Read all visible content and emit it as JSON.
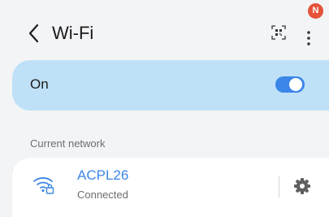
{
  "header": {
    "title": "Wi-Fi",
    "back_icon": "back-chevron-icon",
    "qr_icon": "qr-scan-icon",
    "more_icon": "more-vertical-icon",
    "notification_badge": "N"
  },
  "wifi_toggle": {
    "label": "On",
    "state": "on",
    "accent_color": "#3b86e8"
  },
  "current_network_section": {
    "header": "Current network"
  },
  "network": {
    "name": "ACPL26",
    "status": "Connected",
    "wifi_icon": "wifi-locked-icon",
    "settings_icon": "gear-icon"
  }
}
